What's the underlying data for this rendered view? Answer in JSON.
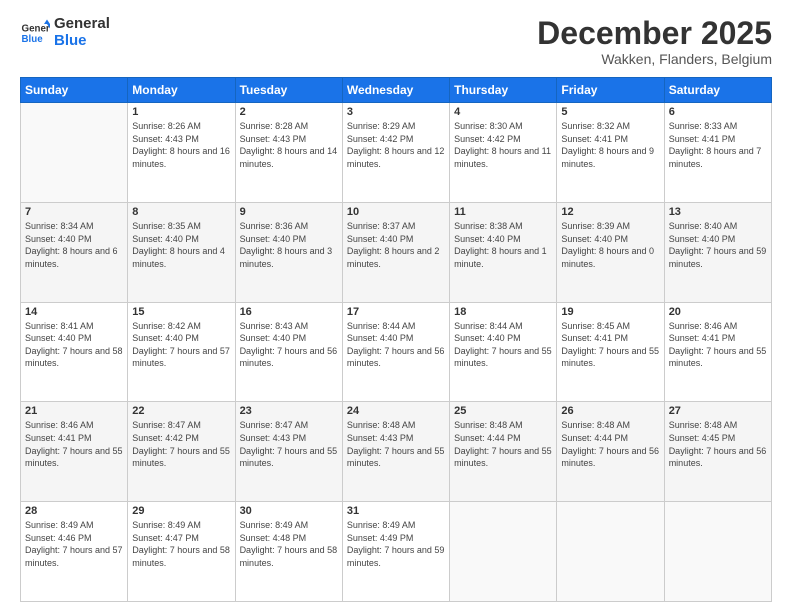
{
  "header": {
    "logo_line1": "General",
    "logo_line2": "Blue",
    "title": "December 2025",
    "subtitle": "Wakken, Flanders, Belgium"
  },
  "days_of_week": [
    "Sunday",
    "Monday",
    "Tuesday",
    "Wednesday",
    "Thursday",
    "Friday",
    "Saturday"
  ],
  "weeks": [
    [
      {
        "day": "",
        "sunrise": "",
        "sunset": "",
        "daylight": "",
        "empty": true
      },
      {
        "day": "1",
        "sunrise": "Sunrise: 8:26 AM",
        "sunset": "Sunset: 4:43 PM",
        "daylight": "Daylight: 8 hours and 16 minutes.",
        "empty": false
      },
      {
        "day": "2",
        "sunrise": "Sunrise: 8:28 AM",
        "sunset": "Sunset: 4:43 PM",
        "daylight": "Daylight: 8 hours and 14 minutes.",
        "empty": false
      },
      {
        "day": "3",
        "sunrise": "Sunrise: 8:29 AM",
        "sunset": "Sunset: 4:42 PM",
        "daylight": "Daylight: 8 hours and 12 minutes.",
        "empty": false
      },
      {
        "day": "4",
        "sunrise": "Sunrise: 8:30 AM",
        "sunset": "Sunset: 4:42 PM",
        "daylight": "Daylight: 8 hours and 11 minutes.",
        "empty": false
      },
      {
        "day": "5",
        "sunrise": "Sunrise: 8:32 AM",
        "sunset": "Sunset: 4:41 PM",
        "daylight": "Daylight: 8 hours and 9 minutes.",
        "empty": false
      },
      {
        "day": "6",
        "sunrise": "Sunrise: 8:33 AM",
        "sunset": "Sunset: 4:41 PM",
        "daylight": "Daylight: 8 hours and 7 minutes.",
        "empty": false
      }
    ],
    [
      {
        "day": "7",
        "sunrise": "Sunrise: 8:34 AM",
        "sunset": "Sunset: 4:40 PM",
        "daylight": "Daylight: 8 hours and 6 minutes.",
        "empty": false
      },
      {
        "day": "8",
        "sunrise": "Sunrise: 8:35 AM",
        "sunset": "Sunset: 4:40 PM",
        "daylight": "Daylight: 8 hours and 4 minutes.",
        "empty": false
      },
      {
        "day": "9",
        "sunrise": "Sunrise: 8:36 AM",
        "sunset": "Sunset: 4:40 PM",
        "daylight": "Daylight: 8 hours and 3 minutes.",
        "empty": false
      },
      {
        "day": "10",
        "sunrise": "Sunrise: 8:37 AM",
        "sunset": "Sunset: 4:40 PM",
        "daylight": "Daylight: 8 hours and 2 minutes.",
        "empty": false
      },
      {
        "day": "11",
        "sunrise": "Sunrise: 8:38 AM",
        "sunset": "Sunset: 4:40 PM",
        "daylight": "Daylight: 8 hours and 1 minute.",
        "empty": false
      },
      {
        "day": "12",
        "sunrise": "Sunrise: 8:39 AM",
        "sunset": "Sunset: 4:40 PM",
        "daylight": "Daylight: 8 hours and 0 minutes.",
        "empty": false
      },
      {
        "day": "13",
        "sunrise": "Sunrise: 8:40 AM",
        "sunset": "Sunset: 4:40 PM",
        "daylight": "Daylight: 7 hours and 59 minutes.",
        "empty": false
      }
    ],
    [
      {
        "day": "14",
        "sunrise": "Sunrise: 8:41 AM",
        "sunset": "Sunset: 4:40 PM",
        "daylight": "Daylight: 7 hours and 58 minutes.",
        "empty": false
      },
      {
        "day": "15",
        "sunrise": "Sunrise: 8:42 AM",
        "sunset": "Sunset: 4:40 PM",
        "daylight": "Daylight: 7 hours and 57 minutes.",
        "empty": false
      },
      {
        "day": "16",
        "sunrise": "Sunrise: 8:43 AM",
        "sunset": "Sunset: 4:40 PM",
        "daylight": "Daylight: 7 hours and 56 minutes.",
        "empty": false
      },
      {
        "day": "17",
        "sunrise": "Sunrise: 8:44 AM",
        "sunset": "Sunset: 4:40 PM",
        "daylight": "Daylight: 7 hours and 56 minutes.",
        "empty": false
      },
      {
        "day": "18",
        "sunrise": "Sunrise: 8:44 AM",
        "sunset": "Sunset: 4:40 PM",
        "daylight": "Daylight: 7 hours and 55 minutes.",
        "empty": false
      },
      {
        "day": "19",
        "sunrise": "Sunrise: 8:45 AM",
        "sunset": "Sunset: 4:41 PM",
        "daylight": "Daylight: 7 hours and 55 minutes.",
        "empty": false
      },
      {
        "day": "20",
        "sunrise": "Sunrise: 8:46 AM",
        "sunset": "Sunset: 4:41 PM",
        "daylight": "Daylight: 7 hours and 55 minutes.",
        "empty": false
      }
    ],
    [
      {
        "day": "21",
        "sunrise": "Sunrise: 8:46 AM",
        "sunset": "Sunset: 4:41 PM",
        "daylight": "Daylight: 7 hours and 55 minutes.",
        "empty": false
      },
      {
        "day": "22",
        "sunrise": "Sunrise: 8:47 AM",
        "sunset": "Sunset: 4:42 PM",
        "daylight": "Daylight: 7 hours and 55 minutes.",
        "empty": false
      },
      {
        "day": "23",
        "sunrise": "Sunrise: 8:47 AM",
        "sunset": "Sunset: 4:43 PM",
        "daylight": "Daylight: 7 hours and 55 minutes.",
        "empty": false
      },
      {
        "day": "24",
        "sunrise": "Sunrise: 8:48 AM",
        "sunset": "Sunset: 4:43 PM",
        "daylight": "Daylight: 7 hours and 55 minutes.",
        "empty": false
      },
      {
        "day": "25",
        "sunrise": "Sunrise: 8:48 AM",
        "sunset": "Sunset: 4:44 PM",
        "daylight": "Daylight: 7 hours and 55 minutes.",
        "empty": false
      },
      {
        "day": "26",
        "sunrise": "Sunrise: 8:48 AM",
        "sunset": "Sunset: 4:44 PM",
        "daylight": "Daylight: 7 hours and 56 minutes.",
        "empty": false
      },
      {
        "day": "27",
        "sunrise": "Sunrise: 8:48 AM",
        "sunset": "Sunset: 4:45 PM",
        "daylight": "Daylight: 7 hours and 56 minutes.",
        "empty": false
      }
    ],
    [
      {
        "day": "28",
        "sunrise": "Sunrise: 8:49 AM",
        "sunset": "Sunset: 4:46 PM",
        "daylight": "Daylight: 7 hours and 57 minutes.",
        "empty": false
      },
      {
        "day": "29",
        "sunrise": "Sunrise: 8:49 AM",
        "sunset": "Sunset: 4:47 PM",
        "daylight": "Daylight: 7 hours and 58 minutes.",
        "empty": false
      },
      {
        "day": "30",
        "sunrise": "Sunrise: 8:49 AM",
        "sunset": "Sunset: 4:48 PM",
        "daylight": "Daylight: 7 hours and 58 minutes.",
        "empty": false
      },
      {
        "day": "31",
        "sunrise": "Sunrise: 8:49 AM",
        "sunset": "Sunset: 4:49 PM",
        "daylight": "Daylight: 7 hours and 59 minutes.",
        "empty": false
      },
      {
        "day": "",
        "sunrise": "",
        "sunset": "",
        "daylight": "",
        "empty": true
      },
      {
        "day": "",
        "sunrise": "",
        "sunset": "",
        "daylight": "",
        "empty": true
      },
      {
        "day": "",
        "sunrise": "",
        "sunset": "",
        "daylight": "",
        "empty": true
      }
    ]
  ]
}
